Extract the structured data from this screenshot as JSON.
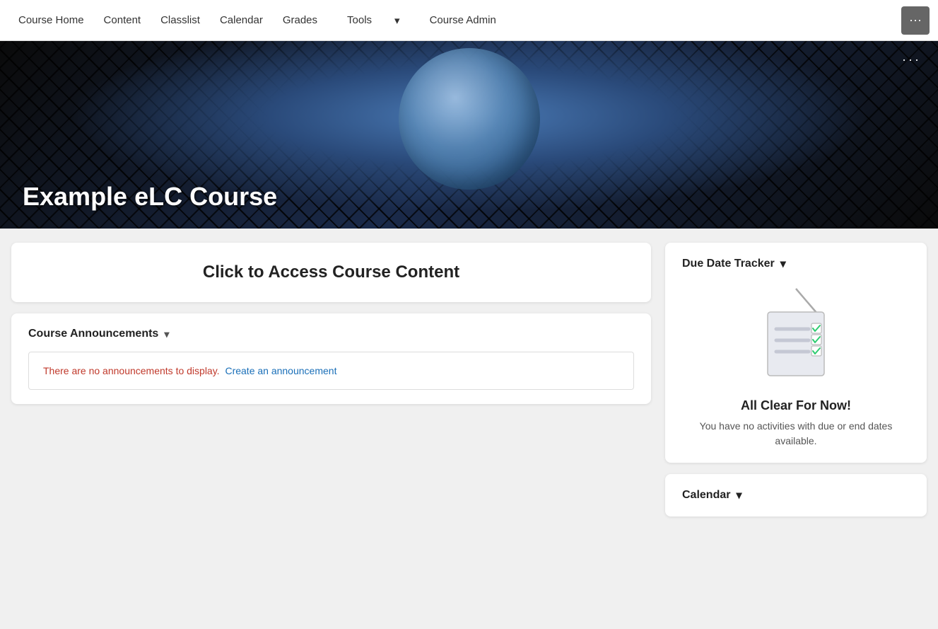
{
  "nav": {
    "items": [
      {
        "label": "Course Home",
        "active": true
      },
      {
        "label": "Content"
      },
      {
        "label": "Classlist"
      },
      {
        "label": "Calendar"
      },
      {
        "label": "Grades"
      },
      {
        "label": "Tools",
        "has_dropdown": true
      },
      {
        "label": "Course Admin"
      }
    ],
    "more_button_label": "···"
  },
  "banner": {
    "title": "Example eLC Course",
    "dots_label": "···"
  },
  "main": {
    "course_content": {
      "title": "Click to Access Course Content"
    },
    "announcements": {
      "section_label": "Course Announcements",
      "chevron": "▾",
      "no_announcements_text": "There are no announcements to display.",
      "create_link_text": "Create an announcement"
    },
    "due_date_tracker": {
      "section_label": "Due Date Tracker",
      "chevron": "▾",
      "all_clear_title": "All Clear For Now!",
      "all_clear_desc": "You have no activities with due or end dates available."
    },
    "calendar": {
      "section_label": "Calendar",
      "chevron": "▾"
    }
  }
}
